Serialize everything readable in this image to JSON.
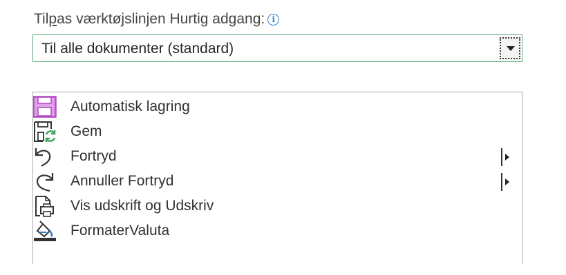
{
  "header": {
    "label_prefix": "Til",
    "label_accel": "p",
    "label_suffix": "as værktøjslinjen Hurtig adgang:",
    "info_glyph": "i"
  },
  "scope_dropdown": {
    "value": "Til alle dokumenter (standard)"
  },
  "commands": [
    {
      "label": "Automatisk lagring",
      "icon": "autosave-icon",
      "has_submenu": false
    },
    {
      "label": "Gem",
      "icon": "save-icon",
      "has_submenu": false
    },
    {
      "label": "Fortryd",
      "icon": "undo-icon",
      "has_submenu": true
    },
    {
      "label": "Annuller Fortryd",
      "icon": "redo-icon",
      "has_submenu": true
    },
    {
      "label": "Vis udskrift og Udskriv",
      "icon": "print-preview-icon",
      "has_submenu": false
    },
    {
      "label": "FormaterValuta",
      "icon": "format-currency-icon",
      "has_submenu": false
    }
  ],
  "colors": {
    "accent_green": "#5ea679",
    "autosave_purple": "#b146c2",
    "info_blue": "#2a7fd4"
  }
}
